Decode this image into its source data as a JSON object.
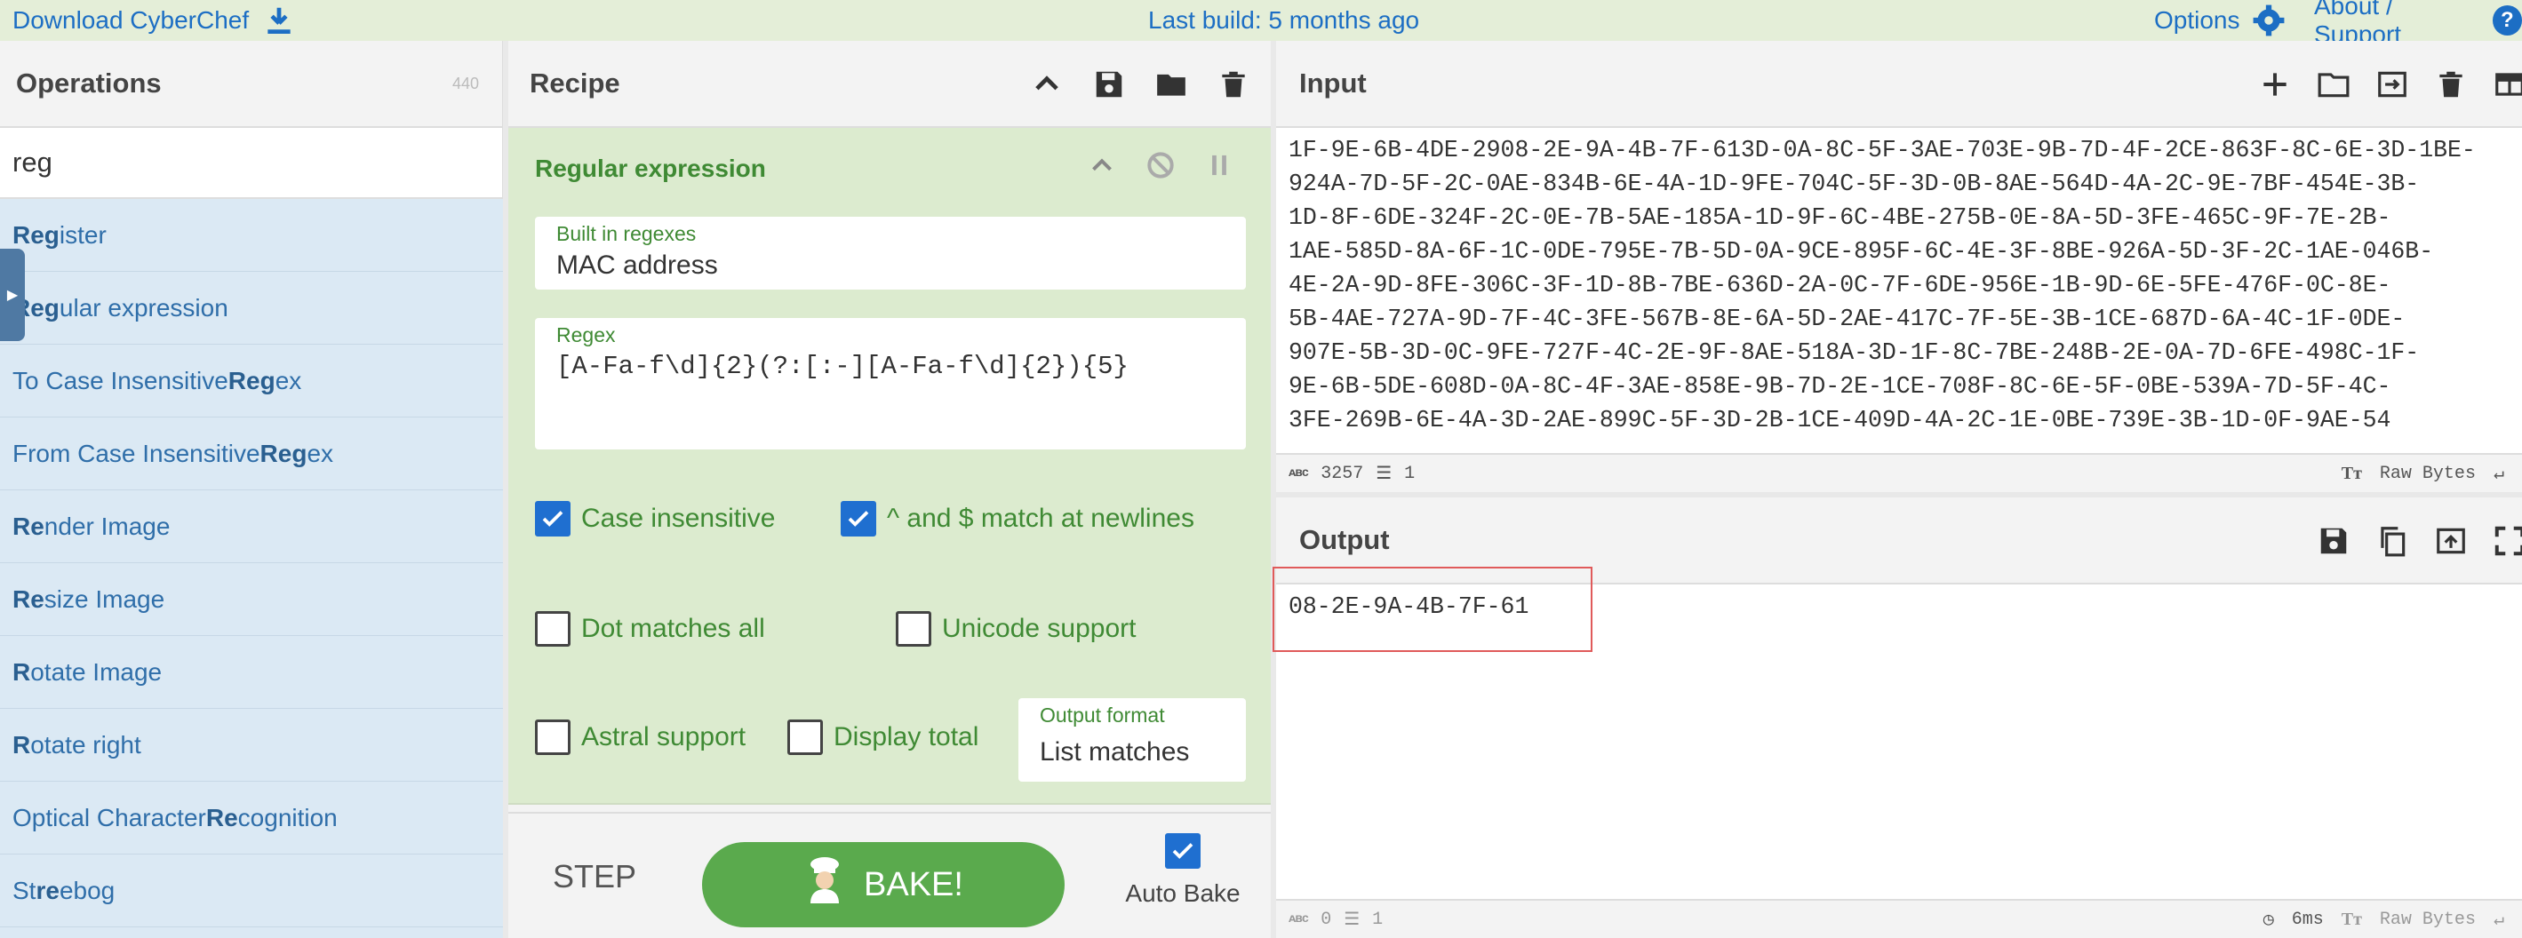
{
  "banner": {
    "download_label": "Download CyberChef",
    "last_build": "Last build: 5 months ago",
    "options_label": "Options",
    "about_label": "About / Support",
    "help_glyph": "?"
  },
  "operations": {
    "title": "Operations",
    "count": "440",
    "search_value": "reg",
    "items": [
      {
        "pre": "",
        "bold": "Reg",
        "post": "ister"
      },
      {
        "pre": "",
        "bold": "Reg",
        "post": "ular expression"
      },
      {
        "pre": "To Case Insensitive ",
        "bold": "Reg",
        "post": "ex"
      },
      {
        "pre": "From Case Insensitive ",
        "bold": "Reg",
        "post": "ex"
      },
      {
        "pre": "",
        "bold": "Re",
        "post": "nder Image"
      },
      {
        "pre": "",
        "bold": "Re",
        "post": "size Image"
      },
      {
        "pre": "",
        "bold": "R",
        "post": "otate Image"
      },
      {
        "pre": "",
        "bold": "R",
        "post": "otate right"
      },
      {
        "pre": "Optical Character ",
        "bold": "Re",
        "post": "cognition"
      },
      {
        "pre": "St",
        "bold": "re",
        "post": "ebog"
      }
    ]
  },
  "recipe": {
    "title": "Recipe",
    "operation": {
      "title": "Regular expression",
      "builtin_label": "Built in regexes",
      "builtin_value": "MAC address",
      "regex_label": "Regex",
      "regex_value": "[A-Fa-f\\d]{2}(?:[:-][A-Fa-f\\d]{2}){5}",
      "checkboxes": {
        "case_insensitive": {
          "label": "Case insensitive",
          "checked": true
        },
        "multiline": {
          "label": "^ and $ match at newlines",
          "checked": true
        },
        "dot_all": {
          "label": "Dot matches all",
          "checked": false
        },
        "unicode": {
          "label": "Unicode support",
          "checked": false
        },
        "astral": {
          "label": "Astral support",
          "checked": false
        },
        "display_total": {
          "label": "Display total",
          "checked": false
        }
      },
      "output_format_label": "Output format",
      "output_format_value": "List matches"
    },
    "step_label": "STEP",
    "bake_label": "BAKE!",
    "auto_bake_label": "Auto Bake",
    "auto_bake_checked": true
  },
  "input": {
    "title": "Input",
    "lines": [
      "1F-9E-6B-4DE-2908-2E-9A-4B-7F-613D-0A-8C-5F-3AE-703E-9B-7D-4F-2CE-863F-8C-6E-3D-1BE-",
      "924A-7D-5F-2C-0AE-834B-6E-4A-1D-9FE-704C-5F-3D-0B-8AE-564D-4A-2C-9E-7BF-454E-3B-",
      "1D-8F-6DE-324F-2C-0E-7B-5AE-185A-1D-9F-6C-4BE-275B-0E-8A-5D-3FE-465C-9F-7E-2B-",
      "1AE-585D-8A-6F-1C-0DE-795E-7B-5D-0A-9CE-895F-6C-4E-3F-8BE-926A-5D-3F-2C-1AE-046B-",
      "4E-2A-9D-8FE-306C-3F-1D-8B-7BE-636D-2A-0C-7F-6DE-956E-1B-9D-6E-5FE-476F-0C-8E-",
      "5B-4AE-727A-9D-7F-4C-3FE-567B-8E-6A-5D-2AE-417C-7F-5E-3B-1CE-687D-6A-4C-1F-0DE-",
      "907E-5B-3D-0C-9FE-727F-4C-2E-9F-8AE-518A-3D-1F-8C-7BE-248B-2E-0A-7D-6FE-498C-1F-",
      "9E-6B-5DE-608D-0A-8C-4F-3AE-858E-9B-7D-2E-1CE-708F-8C-6E-5F-0BE-539A-7D-5F-4C-",
      "3FE-269B-6E-4A-3D-2AE-899C-5F-3D-2B-1CE-409D-4A-2C-1E-0BE-739E-3B-1D-0F-9AE-54"
    ],
    "length": "3257",
    "line_count": "1",
    "mode_label": "Raw Bytes"
  },
  "output": {
    "title": "Output",
    "value": "08-2E-9A-4B-7F-61",
    "length": "0",
    "line_count": "1",
    "time": "6ms",
    "mode_label": "Raw Bytes"
  },
  "colors": {
    "accent_blue": "#1c6ec4",
    "recipe_green": "#3f8a34",
    "bake_green": "#5aaa4d",
    "ops_bg": "#dbe9f4"
  }
}
